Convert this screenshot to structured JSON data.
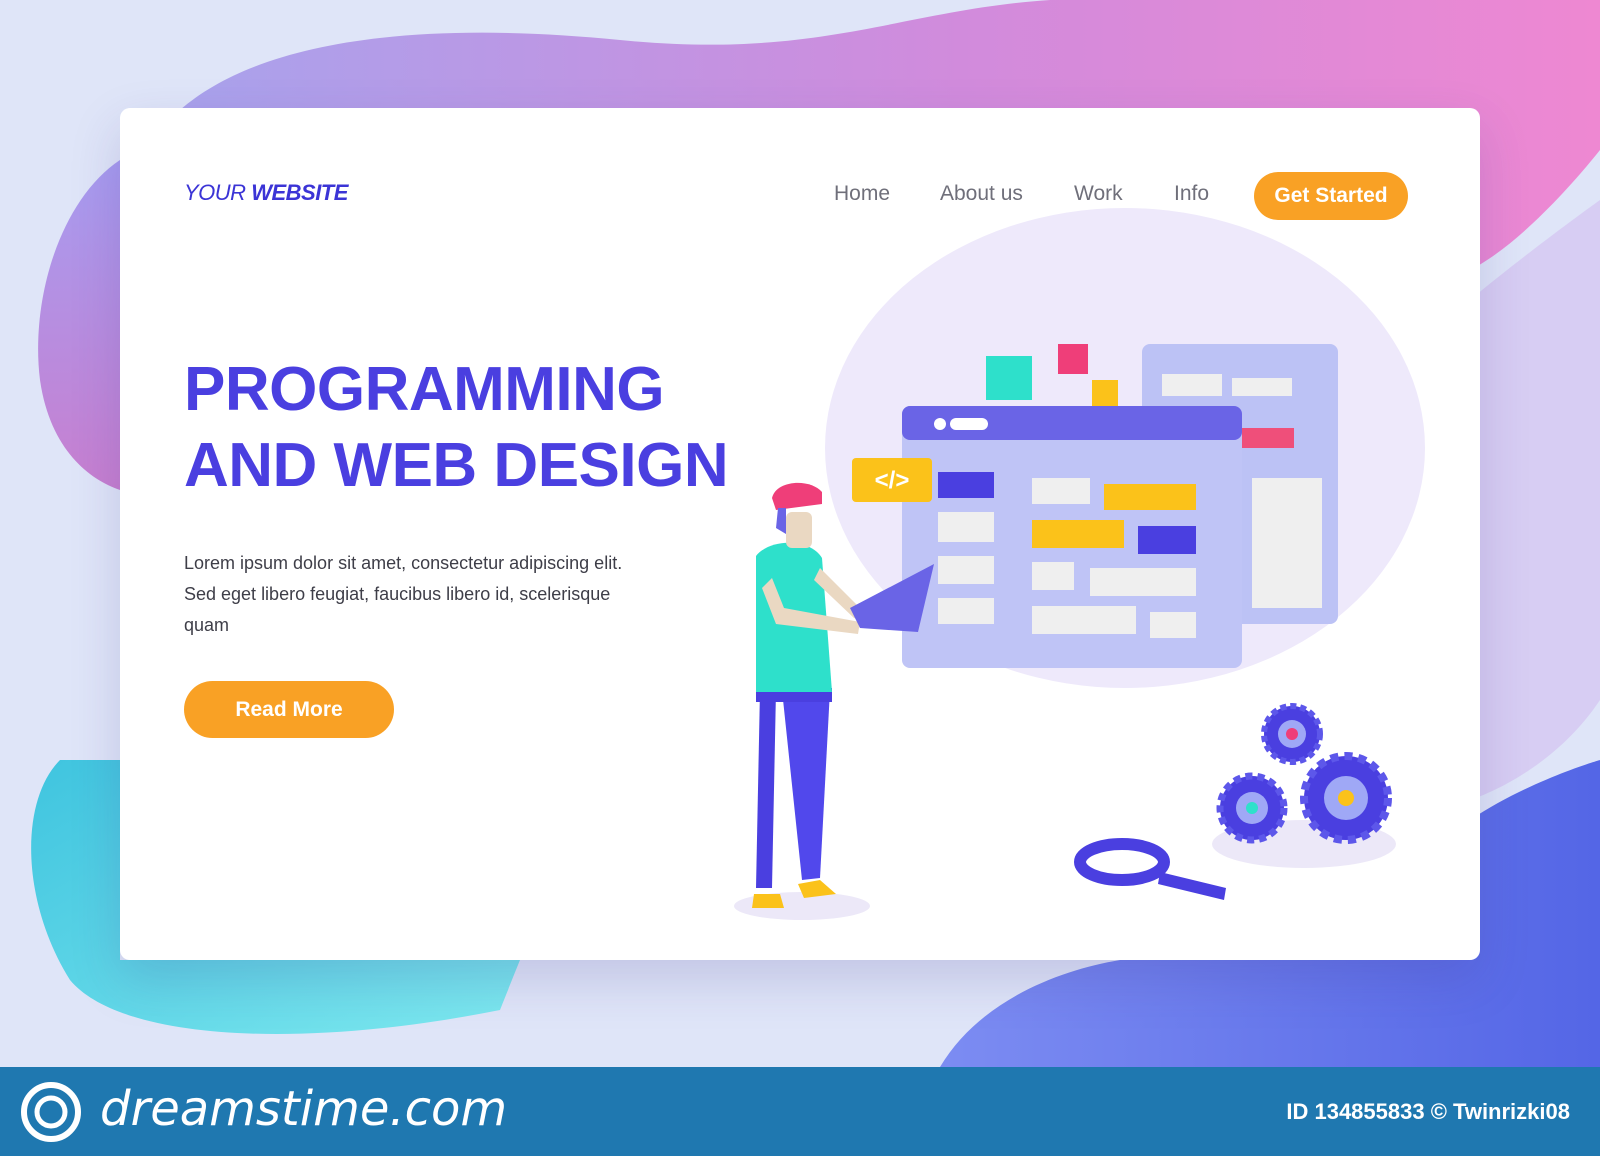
{
  "header": {
    "logo_light": "YOUR ",
    "logo_bold": "WEBSITE",
    "nav": [
      "Home",
      "About us",
      "Work",
      "Info"
    ],
    "cta": "Get Started"
  },
  "hero": {
    "title_line1": "PROGRAMMING",
    "title_line2": "AND WEB DESIGN",
    "description": "Lorem ipsum dolor sit amet, consectetur adipiscing elit. Sed eget libero feugiat, faucibus libero id, scelerisque quam",
    "button": "Read More"
  },
  "illustration": {
    "code_tag": "</>"
  },
  "footer": {
    "brand": "dreamstime.com",
    "credit": "ID 134855833 © Twinrizki08"
  },
  "colors": {
    "accent": "#4a3fe0",
    "button": "#f9a125",
    "footer": "#1f78b0"
  }
}
